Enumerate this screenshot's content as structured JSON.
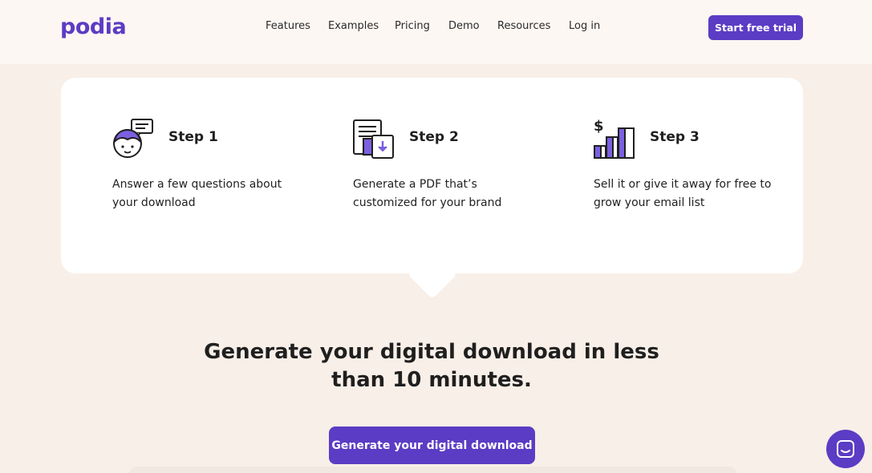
{
  "brand": {
    "logo_text": "podia"
  },
  "nav": {
    "items": [
      {
        "label": "Features"
      },
      {
        "label": "Examples"
      },
      {
        "label": "Pricing"
      },
      {
        "label": "Demo"
      },
      {
        "label": "Resources"
      },
      {
        "label": "Log in"
      }
    ],
    "cta_label": "Start free trial"
  },
  "steps": [
    {
      "title": "Step 1",
      "desc": "Answer a few questions about your download",
      "icon": "person-chat-icon"
    },
    {
      "title": "Step 2",
      "desc": "Generate a PDF that’s customized for your brand",
      "icon": "document-download-icon"
    },
    {
      "title": "Step 3",
      "desc": "Sell it or give it away for free to grow your email list",
      "icon": "dollar-growth-chart-icon"
    }
  ],
  "main": {
    "headline": "Generate your digital download in less than 10 minutes.",
    "cta_label": "Generate your digital download"
  },
  "colors": {
    "accent": "#5b3cc4",
    "background": "#f8efe8",
    "header": "#fdf7f3",
    "card": "#ffffff"
  }
}
